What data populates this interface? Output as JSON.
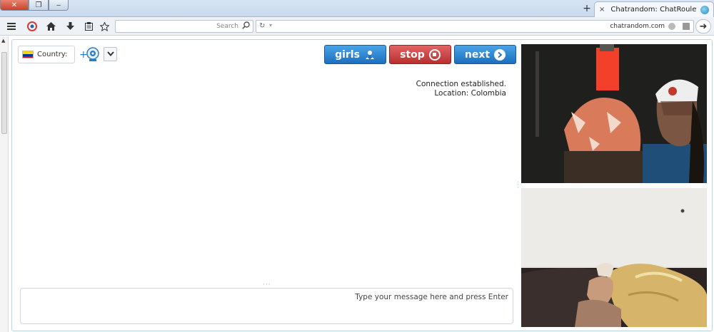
{
  "browser": {
    "tab_title": "Chatrandom: ChatRoulette...",
    "tab_close": "×",
    "new_tab": "+",
    "window": {
      "close": "✕",
      "maximize": "❐",
      "minimize": "‒"
    },
    "search_placeholder": "Search",
    "url": "chatrandom.com",
    "icons": [
      "menu-icon",
      "extension-icon",
      "home-icon",
      "download-icon",
      "reading-list-icon",
      "bookmark-star-icon",
      "search-icon",
      "reload-icon",
      "back-icon"
    ]
  },
  "toolbar": {
    "country_label": "Country:",
    "flag_colors": [
      "#FCD116",
      "#003893",
      "#CE1126"
    ],
    "girls_label": "girls",
    "stop_label": "stop",
    "next_label": "next"
  },
  "chat": {
    "messages": [
      "Connection established.",
      "Location: Colombia"
    ],
    "input_placeholder": "Type your message here and press Enter"
  },
  "colors": {
    "blue_button": "#1d6fbf",
    "red_button": "#b92f2f",
    "panel_border": "#b7d3ea"
  }
}
